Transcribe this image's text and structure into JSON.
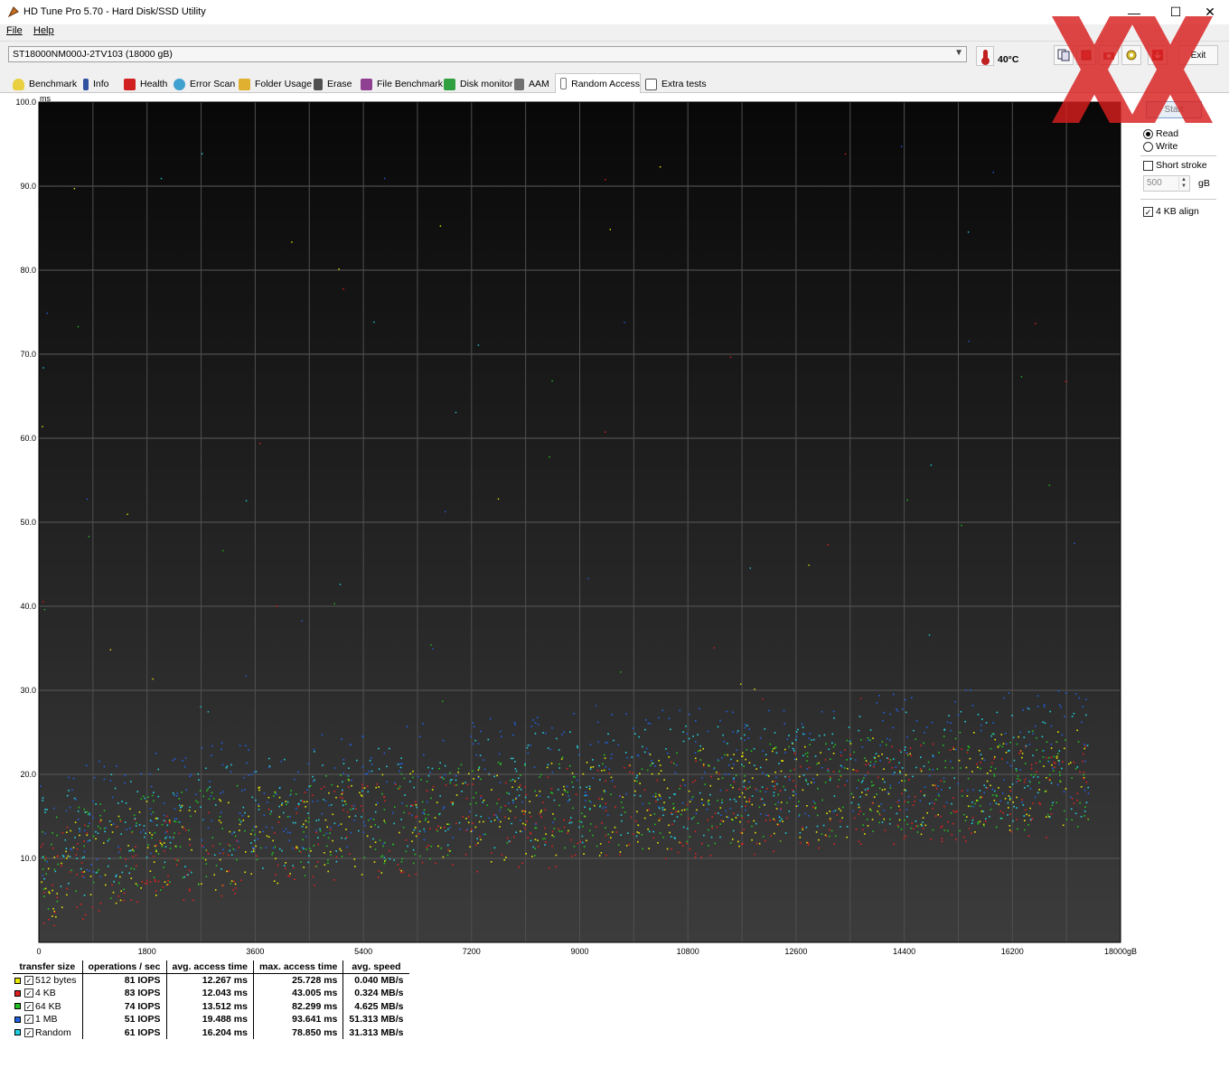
{
  "window": {
    "title": "HD Tune Pro 5.70 - Hard Disk/SSD Utility",
    "minimize": "—",
    "maximize": "☐",
    "close": "✕"
  },
  "menu": {
    "file": "File",
    "help": "Help"
  },
  "drive": {
    "selected": "ST18000NM000J-2TV103 (18000 gB)"
  },
  "temperature": "40°C",
  "toolbar": {
    "exit": "Exit"
  },
  "tabs": [
    {
      "label": "Benchmark",
      "icon": "bulb-icon"
    },
    {
      "label": "Info",
      "icon": "info-icon"
    },
    {
      "label": "Health",
      "icon": "health-cross-icon"
    },
    {
      "label": "Error Scan",
      "icon": "magnifier-icon"
    },
    {
      "label": "Folder Usage",
      "icon": "folder-icon"
    },
    {
      "label": "Erase",
      "icon": "trash-icon"
    },
    {
      "label": "File Benchmark",
      "icon": "file-benchmark-icon"
    },
    {
      "label": "Disk monitor",
      "icon": "disk-monitor-icon"
    },
    {
      "label": "AAM",
      "icon": "speaker-icon"
    },
    {
      "label": "Random Access",
      "icon": "random-access-icon"
    },
    {
      "label": "Extra tests",
      "icon": "extra-tests-icon"
    }
  ],
  "active_tab": "Random Access",
  "controls": {
    "start": "Start",
    "read": "Read",
    "write": "Write",
    "mode": "read",
    "short_stroke": "Short stroke",
    "short_stroke_checked": false,
    "short_stroke_value": "500",
    "short_stroke_unit": "gB",
    "align": "4 KB align",
    "align_checked": true
  },
  "chart_data": {
    "type": "scatter",
    "ylabel": "ms",
    "ylim": [
      0,
      100
    ],
    "xlim": [
      0,
      18000
    ],
    "x_ticks": [
      "0",
      "1800",
      "3600",
      "5400",
      "7200",
      "9000",
      "10800",
      "12600",
      "14400",
      "16200",
      "18000gB"
    ],
    "y_ticks": [
      "10.0",
      "20.0",
      "30.0",
      "40.0",
      "50.0",
      "60.0",
      "70.0",
      "80.0",
      "90.0",
      "100.0"
    ],
    "grid": true,
    "background": [
      "#0a0a0a",
      "#3a3a3a"
    ],
    "series": [
      {
        "name": "512 bytes",
        "color": "#e8e800",
        "base_ms": [
          7,
          20
        ],
        "spread_ms": 6
      },
      {
        "name": "4 KB",
        "color": "#e02020",
        "base_ms": [
          6,
          19
        ],
        "spread_ms": 6
      },
      {
        "name": "64 KB",
        "color": "#20c020",
        "base_ms": [
          8,
          20
        ],
        "spread_ms": 6
      },
      {
        "name": "1 MB",
        "color": "#2060e0",
        "base_ms": [
          12,
          24
        ],
        "spread_ms": 7
      },
      {
        "name": "Random",
        "color": "#20d0e0",
        "base_ms": [
          10,
          22
        ],
        "spread_ms": 7
      }
    ]
  },
  "results": {
    "headers": [
      "transfer size",
      "operations / sec",
      "avg. access time",
      "max. access time",
      "avg. speed"
    ],
    "rows": [
      {
        "label": "512 bytes",
        "color": "#e8e800",
        "ops": "81 IOPS",
        "avg": "12.267 ms",
        "max": "25.728 ms",
        "speed": "0.040 MB/s"
      },
      {
        "label": "4 KB",
        "color": "#e02020",
        "ops": "83 IOPS",
        "avg": "12.043 ms",
        "max": "43.005 ms",
        "speed": "0.324 MB/s"
      },
      {
        "label": "64 KB",
        "color": "#20c020",
        "ops": "74 IOPS",
        "avg": "13.512 ms",
        "max": "82.299 ms",
        "speed": "4.625 MB/s"
      },
      {
        "label": "1 MB",
        "color": "#2060e0",
        "ops": "51 IOPS",
        "avg": "19.488 ms",
        "max": "93.641 ms",
        "speed": "51.313 MB/s"
      },
      {
        "label": "Random",
        "color": "#20d0e0",
        "ops": "61 IOPS",
        "avg": "16.204 ms",
        "max": "78.850 ms",
        "speed": "31.313 MB/s"
      }
    ]
  }
}
